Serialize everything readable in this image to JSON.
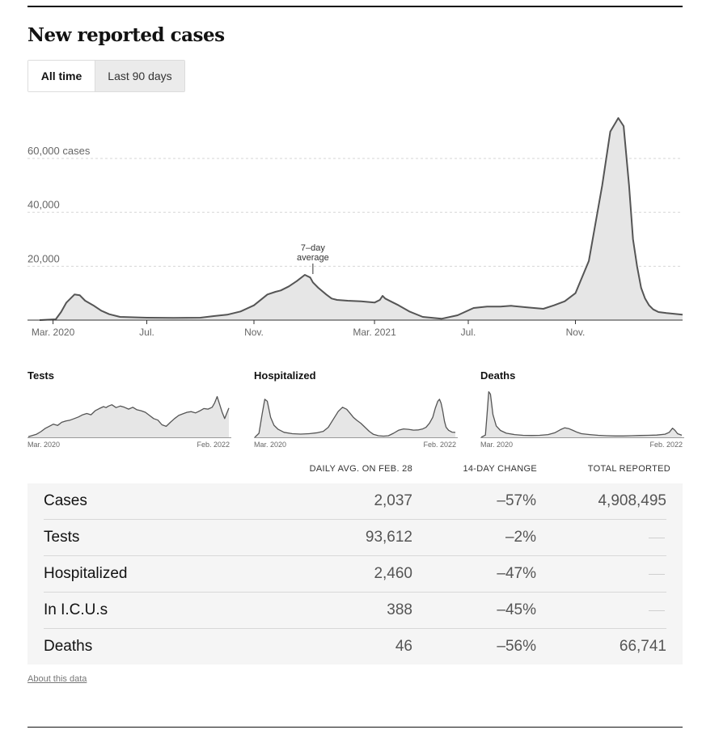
{
  "title": "New reported cases",
  "toggle": {
    "active": "All time",
    "inactive": "Last 90 days"
  },
  "chart_data": [
    {
      "type": "area",
      "title": "New reported cases",
      "y_tick_labels": [
        "60,000 cases",
        "40,000",
        "20,000"
      ],
      "y_ticks": [
        60000,
        40000,
        20000
      ],
      "ylim": [
        0,
        75000
      ],
      "xlim": [
        0,
        24
      ],
      "x_ticks": [
        {
          "x": 0.5,
          "label": "Mar. 2020"
        },
        {
          "x": 4,
          "label": "Jul."
        },
        {
          "x": 8,
          "label": "Nov."
        },
        {
          "x": 12.5,
          "label": "Mar. 2021"
        },
        {
          "x": 16,
          "label": "Jul."
        },
        {
          "x": 20,
          "label": "Nov."
        }
      ],
      "grid": true,
      "annotation": {
        "line1": "7–day",
        "line2": "average",
        "x": 10.2,
        "y": 16800
      },
      "series": [
        {
          "x": [
            0,
            0.6,
            0.8,
            1.0,
            1.3,
            1.5,
            1.7,
            2.0,
            2.3,
            2.6,
            3.0,
            4,
            5,
            6,
            6.5,
            7,
            7.5,
            8,
            8.5,
            8.8,
            9.0,
            9.3,
            9.6,
            9.9,
            10.1,
            10.2,
            10.4,
            10.7,
            10.9,
            11.1,
            11.5,
            12.0,
            12.5,
            12.7,
            12.8,
            12.9,
            13.1,
            13.4,
            13.8,
            14.3,
            15,
            15.6,
            16.2,
            16.7,
            17.2,
            17.6,
            18.2,
            18.8,
            19.2,
            19.6,
            20,
            20.5,
            21,
            21.3,
            21.6,
            21.8,
            22.0,
            22.15,
            22.3,
            22.45,
            22.6,
            22.75,
            22.9,
            23.1,
            23.4,
            23.7,
            24
          ],
          "y": [
            0,
            300,
            3000,
            6500,
            9500,
            9200,
            7200,
            5500,
            3500,
            2200,
            1200,
            900,
            800,
            900,
            1500,
            2000,
            3200,
            5500,
            9500,
            10500,
            11000,
            12500,
            14500,
            16800,
            15800,
            14000,
            12000,
            9500,
            8000,
            7500,
            7200,
            7000,
            6500,
            7500,
            9000,
            8000,
            7000,
            5500,
            3200,
            1200,
            500,
            1800,
            4500,
            5000,
            5000,
            5300,
            4700,
            4200,
            5500,
            7000,
            10000,
            22000,
            50000,
            70000,
            75000,
            72000,
            50000,
            30000,
            20000,
            12000,
            8000,
            5500,
            4000,
            3000,
            2600,
            2300,
            2037
          ]
        }
      ]
    },
    {
      "type": "area",
      "title": "Tests",
      "x_start_label": "Mar. 2020",
      "x_end_label": "Feb. 2022",
      "ylim": [
        0,
        160000
      ],
      "series": [
        {
          "x": [
            0,
            1,
            1.5,
            2,
            2.5,
            3,
            3.5,
            4,
            4.5,
            5,
            5.5,
            6,
            6.5,
            7,
            7.5,
            8,
            8.5,
            9,
            9.3,
            9.6,
            10,
            10.5,
            11,
            11.5,
            12,
            12.5,
            13,
            13.5,
            14,
            14.5,
            15,
            15.5,
            16,
            16.5,
            17,
            17.5,
            18,
            18.5,
            19,
            19.5,
            20,
            20.5,
            21,
            21.5,
            22,
            22.3,
            22.6,
            22.9,
            23.2,
            23.5,
            24
          ],
          "y": [
            2000,
            10000,
            18000,
            28000,
            35000,
            42000,
            38000,
            48000,
            52000,
            55000,
            60000,
            65000,
            72000,
            76000,
            72000,
            85000,
            92000,
            98000,
            95000,
            100000,
            104000,
            95000,
            100000,
            96000,
            90000,
            96000,
            88000,
            85000,
            80000,
            70000,
            60000,
            55000,
            40000,
            35000,
            48000,
            60000,
            70000,
            75000,
            80000,
            82000,
            78000,
            84000,
            92000,
            90000,
            96000,
            110000,
            130000,
            105000,
            80000,
            60000,
            93612
          ]
        }
      ]
    },
    {
      "type": "area",
      "title": "Hospitalized",
      "x_start_label": "Mar. 2020",
      "x_end_label": "Feb. 2022",
      "ylim": [
        0,
        25000
      ],
      "series": [
        {
          "x": [
            0,
            0.5,
            0.9,
            1.2,
            1.5,
            1.9,
            2.3,
            2.8,
            3.5,
            4.5,
            5.5,
            6.5,
            7.5,
            8.2,
            8.8,
            9.4,
            10,
            10.5,
            11,
            11.4,
            11.8,
            12.2,
            12.7,
            13.2,
            13.7,
            14.2,
            14.8,
            15.4,
            16,
            16.6,
            17.2,
            17.8,
            18.4,
            19,
            19.6,
            20.1,
            20.5,
            20.9,
            21.3,
            21.6,
            21.9,
            22.1,
            22.3,
            22.5,
            22.7,
            22.9,
            23.2,
            23.6,
            24
          ],
          "y": [
            0,
            2000,
            12000,
            19000,
            18000,
            10000,
            6000,
            4000,
            2500,
            1800,
            1600,
            1800,
            2300,
            3000,
            5000,
            9000,
            13000,
            15000,
            14000,
            12000,
            10000,
            8500,
            7000,
            5000,
            3000,
            1500,
            800,
            600,
            800,
            2000,
            3500,
            4200,
            4000,
            3600,
            3700,
            4200,
            5000,
            7000,
            10000,
            14500,
            18000,
            19000,
            17000,
            13000,
            8000,
            5000,
            3500,
            2600,
            2460
          ]
        }
      ]
    },
    {
      "type": "area",
      "title": "Deaths",
      "x_start_label": "Mar. 2020",
      "x_end_label": "Feb. 2022",
      "ylim": [
        0,
        1100
      ],
      "series": [
        {
          "x": [
            0,
            0.5,
            0.7,
            0.9,
            1.1,
            1.4,
            1.8,
            2.3,
            3,
            4,
            5,
            6,
            7,
            8,
            8.8,
            9.5,
            10,
            10.5,
            11,
            11.5,
            12,
            13,
            14,
            15,
            16,
            17,
            18,
            19,
            20,
            21,
            22,
            22.5,
            22.9,
            23.2,
            23.5,
            24
          ],
          "y": [
            0,
            50,
            500,
            1000,
            950,
            500,
            250,
            150,
            90,
            60,
            45,
            40,
            45,
            60,
            100,
            170,
            210,
            190,
            150,
            110,
            80,
            60,
            45,
            35,
            30,
            30,
            35,
            40,
            45,
            50,
            70,
            110,
            200,
            150,
            80,
            46
          ]
        }
      ]
    }
  ],
  "table": {
    "headers": {
      "daily": "DAILY AVG. ON FEB. 28",
      "change": "14-DAY CHANGE",
      "total": "TOTAL REPORTED"
    },
    "rows": [
      {
        "name": "Cases",
        "daily": "2,037",
        "change": "–57%",
        "total": "4,908,495"
      },
      {
        "name": "Tests",
        "daily": "93,612",
        "change": "–2%",
        "total": ""
      },
      {
        "name": "Hospitalized",
        "daily": "2,460",
        "change": "–47%",
        "total": ""
      },
      {
        "name": "In I.C.U.s",
        "daily": "388",
        "change": "–45%",
        "total": ""
      },
      {
        "name": "Deaths",
        "daily": "46",
        "change": "–56%",
        "total": "66,741"
      }
    ]
  },
  "about_link": "About this data",
  "colors": {
    "line": "#555555",
    "fill": "#e6e6e6",
    "grid": "#d6d6d6",
    "axis_text": "#666666",
    "table_bg": "#f5f5f5"
  }
}
